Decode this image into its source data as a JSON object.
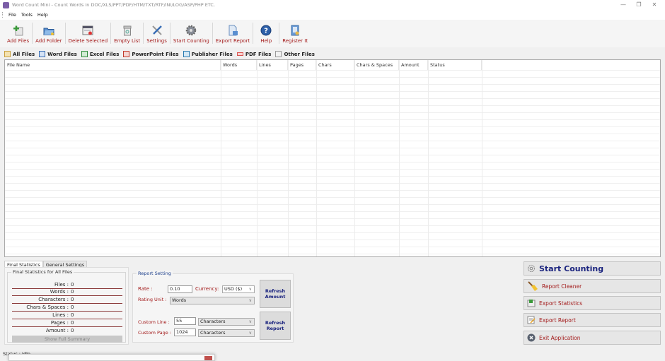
{
  "window": {
    "title": "Word Count Mini - Count Words in DOC/XLS/PPT/PDF/HTM/TXT/RTF/INI/LOG/ASP/PHP ETC.",
    "controls": {
      "minimize": "—",
      "maximize": "❐",
      "close": "✕"
    }
  },
  "menu": [
    "File",
    "Tools",
    "Help"
  ],
  "toolbar": [
    {
      "label": "Add Files",
      "icon": "add-files-icon"
    },
    {
      "label": "Add Folder",
      "icon": "add-folder-icon"
    },
    {
      "label": "Delete Selected",
      "icon": "delete-selected-icon"
    },
    {
      "label": "Empty List",
      "icon": "empty-list-icon"
    },
    {
      "label": "Settings",
      "icon": "settings-icon"
    },
    {
      "label": "Start Counting",
      "icon": "gear-icon"
    },
    {
      "label": "Export Report",
      "icon": "export-report-icon"
    },
    {
      "label": "Help",
      "icon": "help-icon"
    },
    {
      "label": "Register It",
      "icon": "register-icon"
    }
  ],
  "file_tabs": [
    {
      "label": "All Files",
      "color": "#e8b84a"
    },
    {
      "label": "Word Files",
      "color": "#3b6fb6"
    },
    {
      "label": "Excel Files",
      "color": "#2e8b3a"
    },
    {
      "label": "PowerPoint Files",
      "color": "#c0392b"
    },
    {
      "label": "Publisher Files",
      "color": "#2a7ab0"
    },
    {
      "label": "PDF Files",
      "color": "#d9534f"
    },
    {
      "label": "Other Files",
      "color": "#999999"
    }
  ],
  "grid": {
    "columns": [
      "File Name",
      "Words",
      "Lines",
      "Pages",
      "Chars",
      "Chars & Spaces",
      "Amount",
      "Status"
    ],
    "rows": []
  },
  "bottom_tabs": [
    "Final Statistics",
    "General Settings"
  ],
  "final_stats": {
    "legend": "Final Statistics for All Files",
    "rows": [
      {
        "key": "Files :",
        "value": "0"
      },
      {
        "key": "Words :",
        "value": "0"
      },
      {
        "key": "Characters :",
        "value": "0"
      },
      {
        "key": "Chars & Spaces :",
        "value": "0"
      },
      {
        "key": "Lines :",
        "value": "0"
      },
      {
        "key": "Pages :",
        "value": "0"
      },
      {
        "key": "Amount :",
        "value": "0"
      }
    ],
    "summary_button": "Show Full Summary"
  },
  "report_setting": {
    "legend": "Report Setting",
    "rate_label": "Rate :",
    "rate_value": "0.10",
    "currency_label": "Currency:",
    "currency_value": "USD ($)",
    "rating_unit_label": "Rating Unit :",
    "rating_unit_value": "Words",
    "refresh_amount": "Refresh Amount",
    "custom_line_label": "Custom Line :",
    "custom_line_value": "55",
    "custom_line_unit": "Characters",
    "custom_page_label": "Custom Page :",
    "custom_page_value": "1024",
    "custom_page_unit": "Characters",
    "refresh_report": "Refresh Report"
  },
  "actions": [
    {
      "label": "Start Counting",
      "icon": "gear-icon",
      "primary": true
    },
    {
      "label": "Report Cleaner",
      "icon": "broom-icon"
    },
    {
      "label": "Export Statistics",
      "icon": "export-statistics-icon"
    },
    {
      "label": "Export Report",
      "icon": "export-report-icon"
    },
    {
      "label": "Exit Application",
      "icon": "exit-icon"
    }
  ],
  "status": {
    "text": "Status : Idle"
  },
  "colors": {
    "label_red": "#a31b1b",
    "primary_blue": "#1a237e",
    "stat_line": "#8b3a3a"
  }
}
